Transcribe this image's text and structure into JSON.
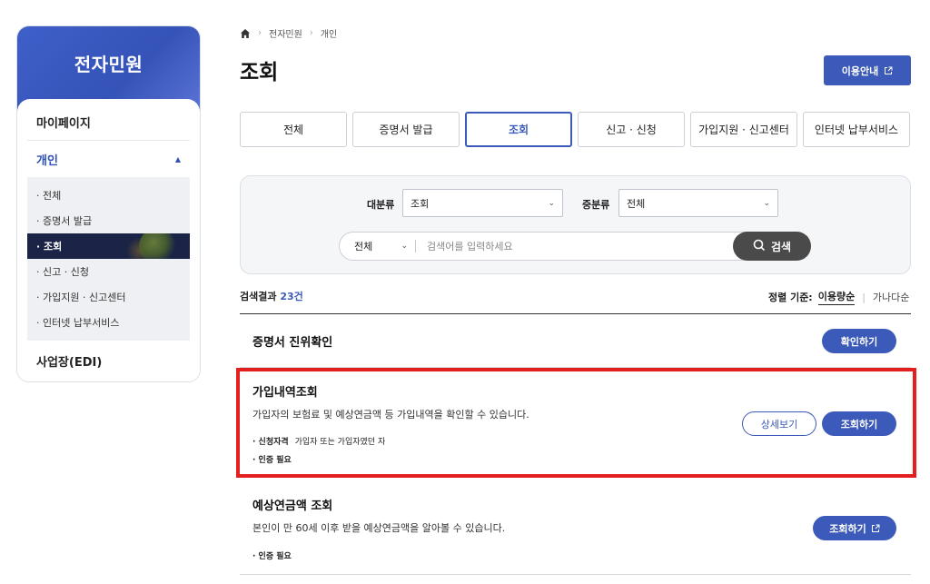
{
  "sidebar": {
    "title": "전자민원",
    "items": [
      {
        "label": "마이페이지"
      },
      {
        "label": "개인"
      },
      {
        "label": "사업장(EDI)"
      }
    ],
    "sub_items": [
      {
        "label": "· 전체"
      },
      {
        "label": "· 증명서 발급"
      },
      {
        "label": "· 조회"
      },
      {
        "label": "· 신고 · 신청"
      },
      {
        "label": "· 가입지원 · 신고센터"
      },
      {
        "label": "· 인터넷 납부서비스"
      }
    ]
  },
  "breadcrumb": {
    "items": [
      "전자민원",
      "개인"
    ]
  },
  "page": {
    "title": "조회",
    "guide_button": "이용안내"
  },
  "tabs": [
    {
      "label": "전체"
    },
    {
      "label": "증명서 발급"
    },
    {
      "label": "조회"
    },
    {
      "label": "신고 · 신청"
    },
    {
      "label": "가입지원 · 신고센터"
    },
    {
      "label": "인터넷 납부서비스"
    }
  ],
  "search": {
    "category_label": "대분류",
    "category_value": "조회",
    "subcategory_label": "중분류",
    "subcategory_value": "전체",
    "type_value": "전체",
    "placeholder": "검색어를 입력하세요",
    "button": "검색"
  },
  "results": {
    "count_prefix": "검색결과",
    "count": "23건",
    "sort_label": "정렬 기준:",
    "sort_active": "이용량순",
    "sort_other": "가나다순"
  },
  "items": [
    {
      "title": "증명서 진위확인",
      "button": "확인하기"
    },
    {
      "title": "가입내역조회",
      "desc": "가입자의 보험료 및 예상연금액 등 가입내역을 확인할 수 있습니다.",
      "meta_label": "· 신청자격",
      "meta_value": "가입자 또는 가입자였던 자",
      "auth": "· 인증 필요",
      "detail_button": "상세보기",
      "button": "조회하기"
    },
    {
      "title": "예상연금액 조회",
      "desc": "본인이 만 60세 이후 받을 예상연금액을 알아볼 수 있습니다.",
      "auth": "· 인증 필요",
      "button": "조회하기"
    }
  ],
  "colors": {
    "accent": "#3c5ab9",
    "highlight": "#e41f1f",
    "selected_dark": "#1b2446"
  }
}
